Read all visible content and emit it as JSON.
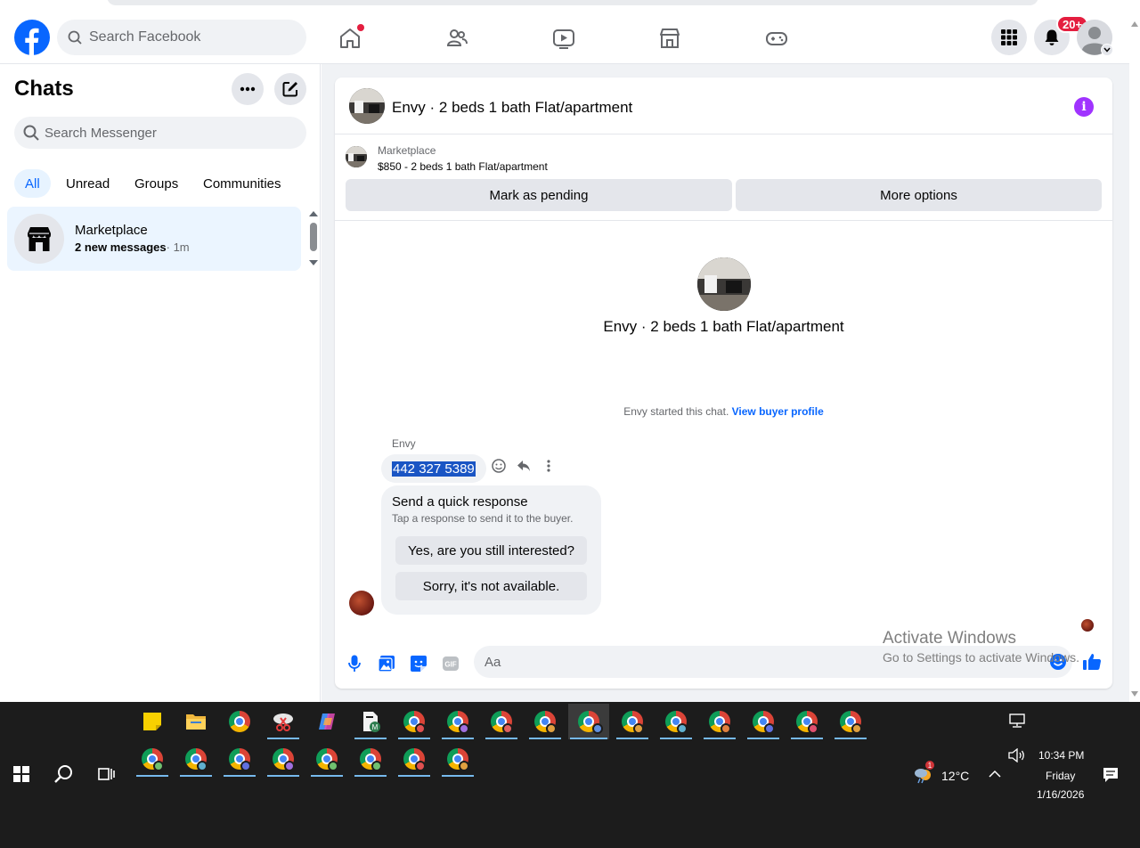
{
  "header": {
    "search_placeholder": "Search Facebook",
    "notification_count": "20+"
  },
  "sidebar": {
    "title": "Chats",
    "search_placeholder": "Search Messenger",
    "filters": [
      "All",
      "Unread",
      "Groups",
      "Communities"
    ],
    "active_filter": "All",
    "conversations": [
      {
        "name": "Marketplace",
        "unread_text": "2 new messages",
        "time": "· 1m"
      }
    ]
  },
  "chat": {
    "title": "Envy · 2 beds 1 bath Flat/apartment",
    "listing": {
      "label": "Marketplace",
      "price_title": "$850 - 2 beds 1 bath Flat/apartment",
      "mark_pending": "Mark as pending",
      "more_options": "More options"
    },
    "hero_title": "Envy · 2 beds 1 bath Flat/apartment",
    "started_text": "Envy started this chat.",
    "view_profile": "View buyer profile",
    "sender": "Envy",
    "message": "442 327 5389",
    "quick_title": "Send a quick response",
    "quick_sub": "Tap a response to send it to the buyer.",
    "quick_replies": [
      "Yes, are you still interested?",
      "Sorry, it's not available."
    ],
    "composer_placeholder": "Aa"
  },
  "watermark": {
    "line1": "Activate Windows",
    "line2": "Go to Settings to activate Windows."
  },
  "taskbar": {
    "weather": "12°C",
    "time": "10:34 PM",
    "day": "Friday",
    "date": "1/16/2026",
    "weather_badge": "1"
  },
  "colors": {
    "facebook_blue": "#0866ff",
    "selection": "#1a55c4",
    "notification_red": "#e41e3f",
    "info_purple": "#a033ff"
  }
}
